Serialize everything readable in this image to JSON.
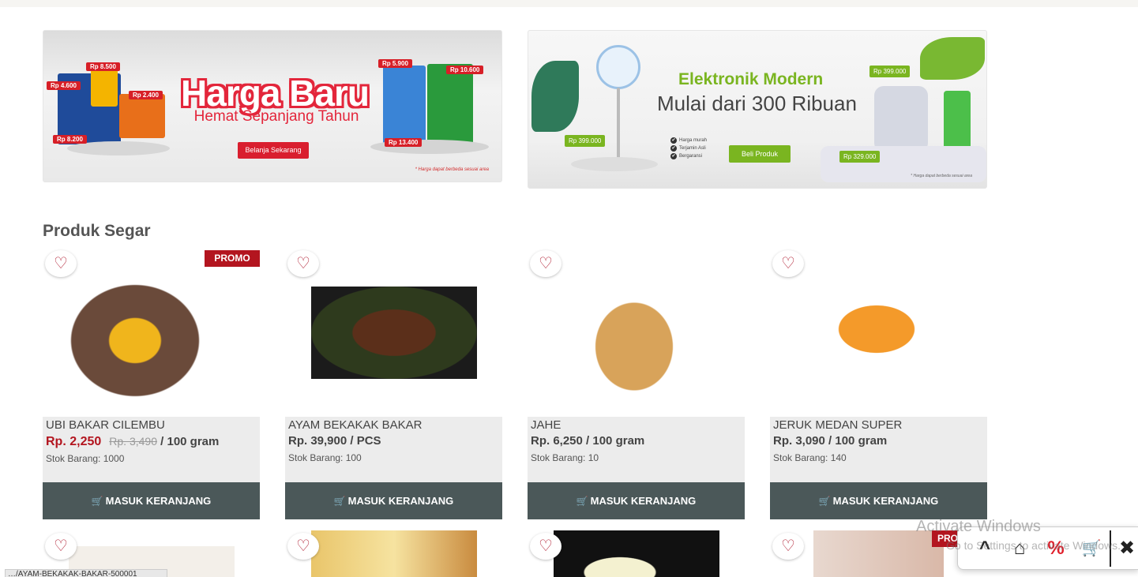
{
  "banners": [
    {
      "title": "Harga Baru",
      "subtitle": "Hemat Sepanjang Tahun",
      "button": "Belanja Sekarang",
      "note": "* Harga dapat berbeda sesuai area",
      "tags": [
        "Rp 8.500",
        "Rp 4.600",
        "Rp 2.400",
        "Rp 8.200",
        "Rp 5.900",
        "Rp 10.600",
        "Rp 13.400"
      ]
    },
    {
      "title": "Elektronik Modern",
      "subtitle": "Mulai dari 300 Ribuan",
      "features": [
        "Harga murah",
        "Terjamin Asli",
        "Bergaransi"
      ],
      "button": "Beli Produk",
      "note": "* Harga dapat berbeda sesuai area",
      "tags": [
        "Rp 399.000",
        "Rp 399.000",
        "Rp 329.000"
      ]
    }
  ],
  "section_title": "Produk Segar",
  "products": [
    {
      "name": "UBI BAKAR CILEMBU",
      "price": "Rp. 2,250",
      "old_price": "Rp. 3,490",
      "unit": " / 100 gram",
      "stock": "Stok Barang: 1000",
      "promo": "PROMO",
      "button": "MASUK KERANJANG"
    },
    {
      "name": "AYAM BEKAKAK BAKAR",
      "price": "Rp. 39,900 / PCS",
      "stock": "Stok Barang: 100",
      "button": "MASUK KERANJANG"
    },
    {
      "name": "JAHE",
      "price": "Rp. 6,250 / 100 gram",
      "stock": "Stok Barang: 10",
      "button": "MASUK KERANJANG"
    },
    {
      "name": "JERUK MEDAN SUPER",
      "price": "Rp. 3,090 / 100 gram",
      "stock": "Stok Barang: 140",
      "button": "MASUK KERANJANG"
    }
  ],
  "row2_promo": "PRO",
  "watermark": {
    "line1": "Activate Windows",
    "line2": "Go to Settings to activate Windows."
  },
  "status_url": "…/AYAM-BEKAKAK-BAKAR-500001",
  "icons": {
    "heart": "heart-outline-icon",
    "cart": "shopping-cart-icon",
    "up": "chevron-up-icon",
    "home": "home-icon",
    "percent": "percent-icon",
    "close": "close-icon"
  },
  "colors": {
    "brand_red": "#b3151f",
    "button_dark": "#4b5859",
    "banner_green": "#7ab520"
  }
}
